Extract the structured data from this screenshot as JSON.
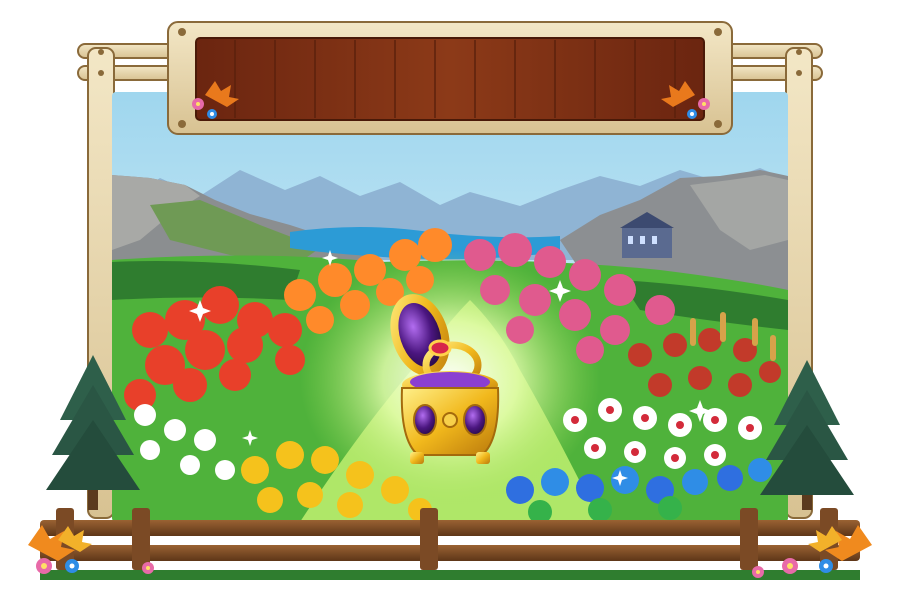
{
  "scene": {
    "banner_text": "",
    "colors": {
      "wood_frame": "#e8d9b0",
      "wood_frame_dark": "#8a6a3a",
      "banner_wood": "#7a2e12",
      "sky_top": "#a9dcef",
      "sky_bottom": "#dff3fa",
      "mountain": "#7f8e9c",
      "lake": "#2c9bd6",
      "grass": "#4fb23b",
      "path_glow": "#c8f08a",
      "fence": "#7b4a25",
      "jewelry_box_gold": "#f0c22a",
      "jewelry_box_purple": "#5b1e8c"
    },
    "icons": [
      "autumn-leaf-icon",
      "pink-flower-icon",
      "blue-flower-icon",
      "pine-tree-icon",
      "jewelry-box-icon",
      "ring-icon",
      "castle-icon"
    ],
    "flower_beds": [
      "red-flowers",
      "orange-lilies",
      "pink-flowers",
      "strawberries",
      "white-red-flowers",
      "blue-flowers",
      "white-lilies",
      "golden-callas"
    ]
  }
}
